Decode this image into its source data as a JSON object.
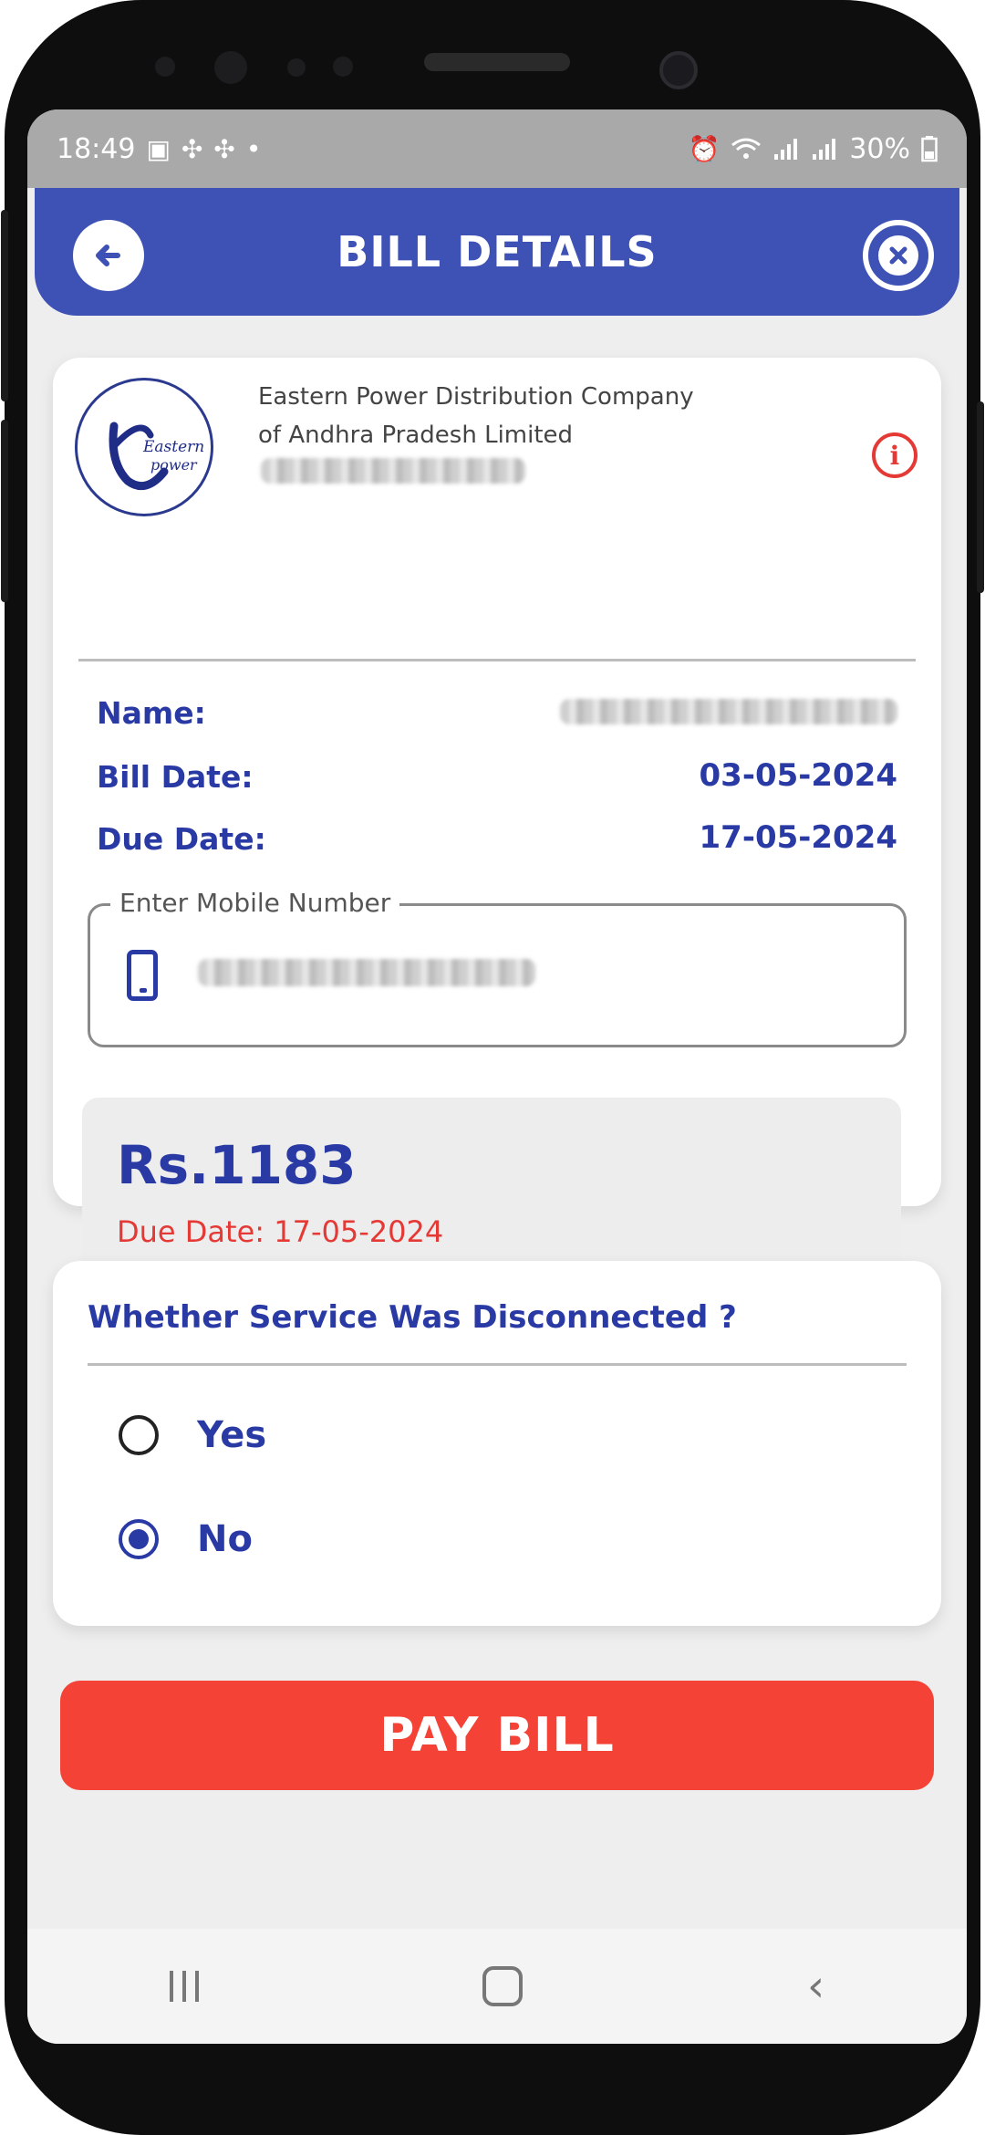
{
  "status_bar": {
    "time": "18:49",
    "left_icons": [
      "image-icon",
      "pinwheel-icon",
      "pinwheel-icon",
      "dot-icon"
    ],
    "right_icons": [
      "alarm-icon",
      "wifi-icon",
      "signal-icon",
      "signal-icon"
    ],
    "battery": "30%"
  },
  "header": {
    "title": "BILL DETAILS",
    "back_icon": "arrow-left-icon",
    "close_icon": "close-circle-icon",
    "color": "#3e51b5"
  },
  "biller": {
    "logo_text_1": "Eastern",
    "logo_text_2": "power",
    "name_line_1": "Eastern Power Distribution Company",
    "name_line_2": "of Andhra Pradesh Limited"
  },
  "details": {
    "name_label": "Name:",
    "bill_date_label": "Bill Date:",
    "bill_date_value": "03-05-2024",
    "due_date_label": "Due Date:",
    "due_date_value": "17-05-2024"
  },
  "mobile_field": {
    "legend": "Enter Mobile Number"
  },
  "amount": {
    "value": "Rs.1183",
    "due_text": "Due Date: 17-05-2024"
  },
  "service": {
    "question": "Whether Service Was Disconnected ?",
    "options": [
      {
        "label": "Yes",
        "selected": false
      },
      {
        "label": "No",
        "selected": true
      }
    ]
  },
  "actions": {
    "pay_label": "PAY BILL",
    "pay_color": "#f44336"
  }
}
